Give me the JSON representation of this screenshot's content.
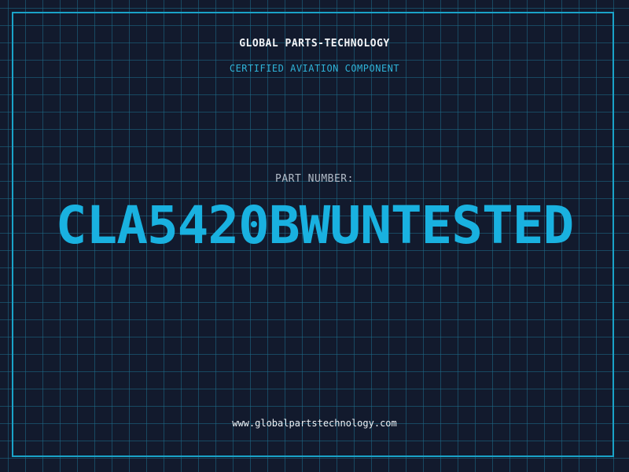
{
  "header": {
    "company": "GLOBAL PARTS-TECHNOLOGY",
    "subtitle": "CERTIFIED AVIATION COMPONENT"
  },
  "part": {
    "label": "PART NUMBER:",
    "number": "CLA5420BWUNTESTED"
  },
  "footer": {
    "website": "www.globalpartstechnology.com"
  },
  "colors": {
    "background": "#121a2d",
    "grid": "#1e6e8c",
    "accent": "#19b1e0",
    "frame": "#1aa3c8"
  }
}
